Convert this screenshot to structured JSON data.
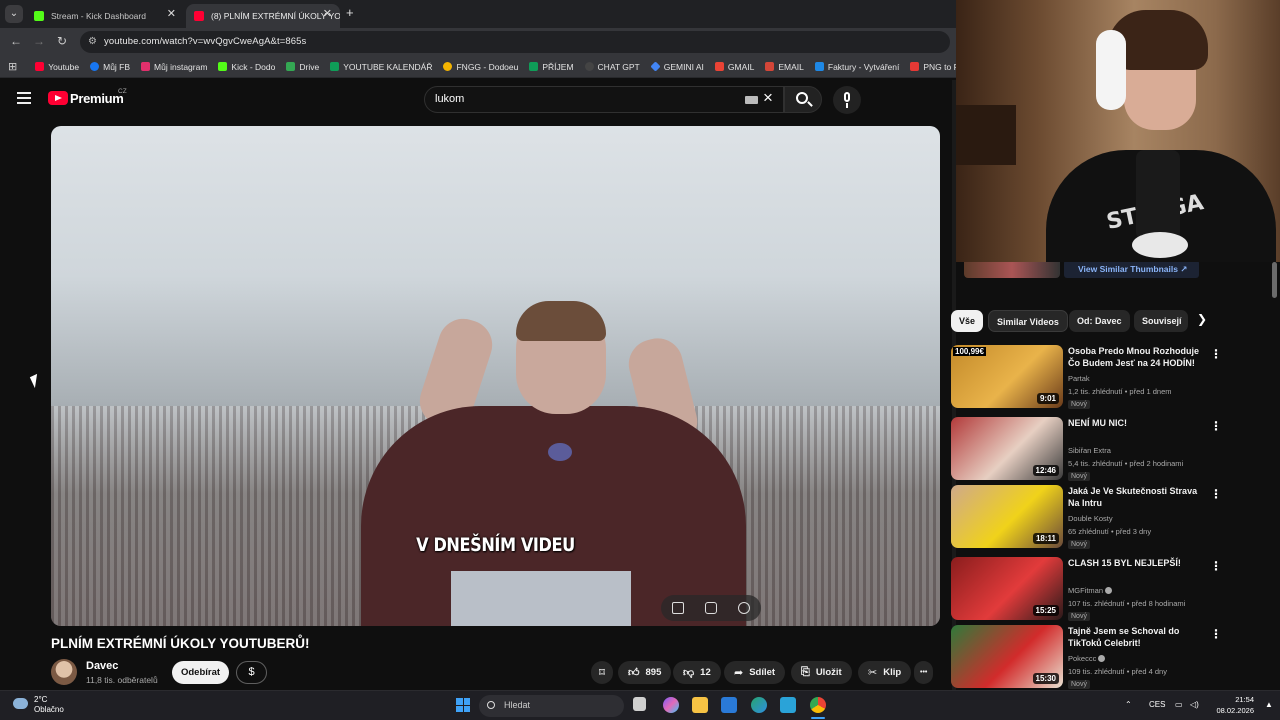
{
  "browser": {
    "tab_list_icon": "chevron-down-icon",
    "tabs": [
      {
        "title": "Stream - Kick Dashboard",
        "favicon_color": "#53fc18",
        "active": false
      },
      {
        "title": "(8) PLNÍM EXTRÉMNÍ ÚKOLY YO",
        "favicon_color": "#ff0033",
        "active": true
      }
    ],
    "new_tab_label": "+",
    "url": "youtube.com/watch?v=wvQgvCweAgA&t=865s",
    "bookmarks": [
      {
        "label": "Youtube",
        "color": "#ff0033"
      },
      {
        "label": "Můj FB",
        "color": "#1877f2"
      },
      {
        "label": "Můj instagram",
        "color": "#e1306c"
      },
      {
        "label": "Kick - Dodo",
        "color": "#53fc18"
      },
      {
        "label": "Drive",
        "color": "#34a853"
      },
      {
        "label": "YOUTUBE KALENDÁŘ",
        "color": "#0f9d58"
      },
      {
        "label": "FNGG - Dodoeu",
        "color": "#f4b400"
      },
      {
        "label": "PŘÍJEM",
        "color": "#0f9d58"
      },
      {
        "label": "CHAT GPT",
        "color": "#444444"
      },
      {
        "label": "GEMINI AI",
        "color": "#4285f4"
      },
      {
        "label": "GMAIL",
        "color": "#ea4335"
      },
      {
        "label": "EMAIL",
        "color": "#d44638"
      },
      {
        "label": "Faktury - Vytváření",
        "color": "#1e88e5"
      },
      {
        "label": "PNG to PDF",
        "color": "#e53935"
      }
    ]
  },
  "header": {
    "logo_text": "Premium",
    "logo_region": "CZ",
    "search_value": "lukom"
  },
  "video": {
    "subtitle": "V DNEŠNÍM VIDEU",
    "title": "PLNÍM EXTRÉMNÍ ÚKOLY YOUTUBERŮ!",
    "channel": "Davec",
    "subscribers": "11,8 tis. odběratelů",
    "subscribe_label": "Odebírat",
    "dollar_label": "$",
    "likes": "895",
    "dislikes": "12",
    "share_label": "Sdílet",
    "save_label": "Uložit",
    "clip_label": "Klip",
    "more_label": "•••"
  },
  "sidebar": {
    "similar_thumbnails_label": "View Similar Thumbnails",
    "chips": [
      "Vše",
      "Similar Videos",
      "Od: Davec",
      "Souvisejí"
    ],
    "recommendations": [
      {
        "title": "Osoba Predo Mnou Rozhoduje Čo Budem Jesť na 24 HODÍN!",
        "channel": "Partak",
        "meta": "1,2 tis. zhlédnutí • před 1 dnem",
        "badge": "Nový",
        "duration": "9:01",
        "thumb_badge": "100,99€",
        "thumb_colors": [
          "#c38a2a",
          "#e9b34a",
          "#6a3b1a"
        ],
        "verified": false
      },
      {
        "title": "NENÍ MU NIC!",
        "channel": "Sibiřan Extra",
        "meta": "5,4 tis. zhlédnutí • před 2 hodinami",
        "badge": "Nový",
        "duration": "12:46",
        "thumb_badge": "",
        "thumb_colors": [
          "#b23a3a",
          "#e7cfc2",
          "#3b3b3b"
        ],
        "verified": false
      },
      {
        "title": "Jaká Je Ve Skutečnosti Strava Na Intru",
        "channel": "Double Kosty",
        "meta": "65 zhlédnutí • před 3 dny",
        "badge": "Nový",
        "duration": "18:11",
        "thumb_badge": "",
        "thumb_colors": [
          "#cfa98a",
          "#f0d21a",
          "#6a4a3a"
        ],
        "verified": false
      },
      {
        "title": "CLASH 15 BYL NEJLEPŠÍ!",
        "channel": "MGFitman",
        "meta": "107 tis. zhlédnutí • před 8 hodinami",
        "badge": "Nový",
        "duration": "15:25",
        "thumb_badge": "",
        "thumb_colors": [
          "#8a1d1d",
          "#e23b3b",
          "#2a1a1a"
        ],
        "verified": true
      },
      {
        "title": "Tajně Jsem se Schoval do TikToků Celebrit!",
        "channel": "Pokeccc",
        "meta": "109 tis. zhlédnutí • před 4 dny",
        "badge": "Nový",
        "duration": "15:30",
        "thumb_badge": "",
        "thumb_colors": [
          "#2f7a3a",
          "#d22b2b",
          "#e9e0d0"
        ],
        "verified": true
      }
    ]
  },
  "taskbar": {
    "temperature": "2°C",
    "weather": "Oblačno",
    "search_placeholder": "Hledat",
    "language": "CES",
    "time": "21:54",
    "date": "08.02.2026"
  }
}
